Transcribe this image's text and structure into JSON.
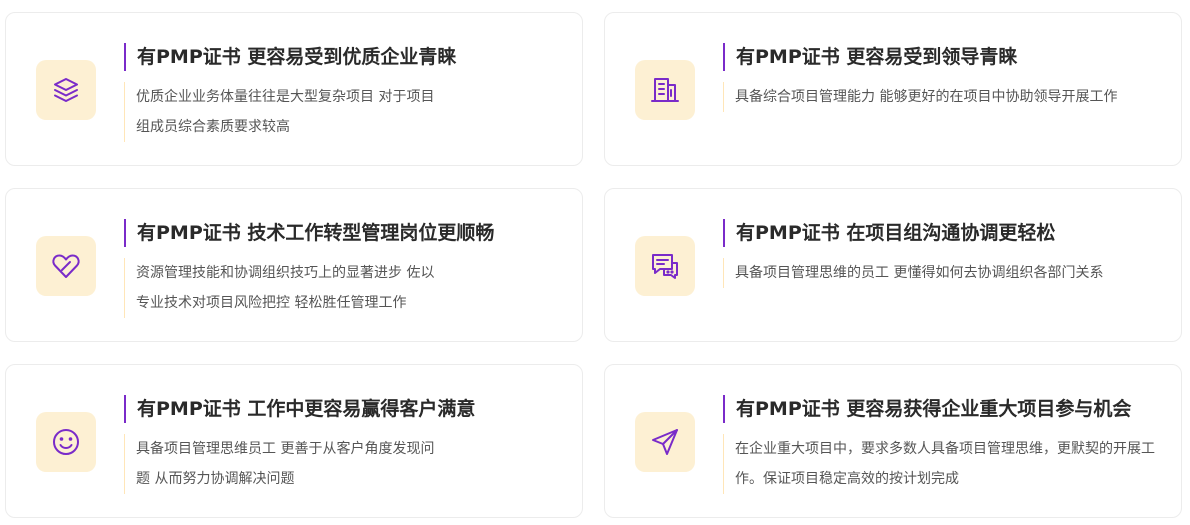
{
  "colors": {
    "accent": "#7a2bc9",
    "icon_bg": "#fdf0d3",
    "title_text": "#2a2a2a",
    "desc_text": "#555555"
  },
  "cards": [
    {
      "icon": "layers-icon",
      "title": "有PMP证书 更容易受到优质企业青睐",
      "description": "优质企业业务体量往往是大型复杂项目 对于项目组成员综合素质要求较高"
    },
    {
      "icon": "building-icon",
      "title": "有PMP证书 更容易受到领导青睐",
      "description": "具备综合项目管理能力 能够更好的在项目中协助领导开展工作"
    },
    {
      "icon": "heart-icon",
      "title": "有PMP证书 技术工作转型管理岗位更顺畅",
      "description": "资源管理技能和协调组织技巧上的显著进步 佐以专业技术对项目风险把控 轻松胜任管理工作"
    },
    {
      "icon": "chat-icon",
      "title": "有PMP证书 在项目组沟通协调更轻松",
      "description": "具备项目管理思维的员工 更懂得如何去协调组织各部门关系"
    },
    {
      "icon": "smile-icon",
      "title": "有PMP证书 工作中更容易赢得客户满意",
      "description": "具备项目管理思维员工 更善于从客户角度发现问题 从而努力协调解决问题"
    },
    {
      "icon": "send-icon",
      "title": "有PMP证书 更容易获得企业重大项目参与机会",
      "description": "在企业重大项目中，要求多数人具备项目管理思维，更默契的开展工作。保证项目稳定高效的按计划完成"
    }
  ]
}
